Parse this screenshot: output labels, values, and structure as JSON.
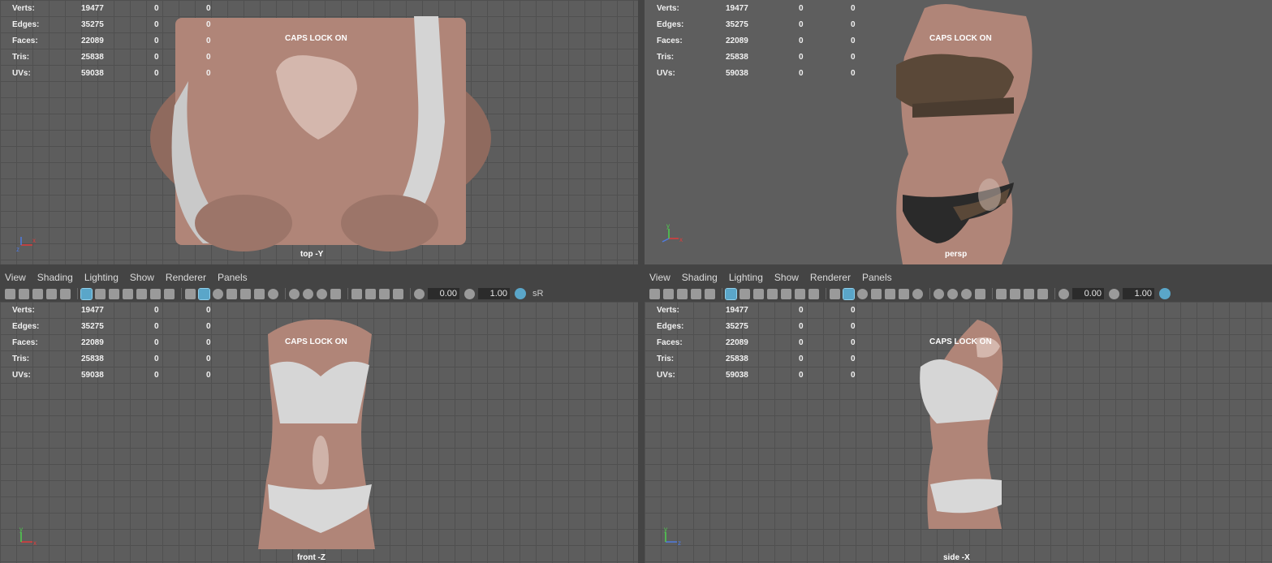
{
  "stats": {
    "labels": [
      "Verts:",
      "Edges:",
      "Faces:",
      "Tris:",
      "UVs:"
    ],
    "values": [
      "19477",
      "35275",
      "22089",
      "25838",
      "59038"
    ],
    "zeros": [
      "0",
      "0"
    ]
  },
  "caps_lock": "CAPS LOCK ON",
  "viewports": {
    "top": "top -Y",
    "persp": "persp",
    "front": "front -Z",
    "side": "side -X"
  },
  "menu": [
    "View",
    "Shading",
    "Lighting",
    "Show",
    "Renderer",
    "Panels"
  ],
  "toolbar": {
    "field_a": "0.00",
    "field_b": "1.00",
    "srgb": "sR"
  },
  "axis": {
    "y": "y",
    "x": "x",
    "z": "z"
  },
  "colors": {
    "skin": "#b48c7e",
    "satin": "#d8d8d8",
    "lace": "#5a4838",
    "viewport_bg": "#5d5d5d",
    "active_tool": "#5aa6c9",
    "axis_x": "#e03b3b",
    "axis_y": "#4fd14f",
    "axis_z": "#4f7be0"
  }
}
